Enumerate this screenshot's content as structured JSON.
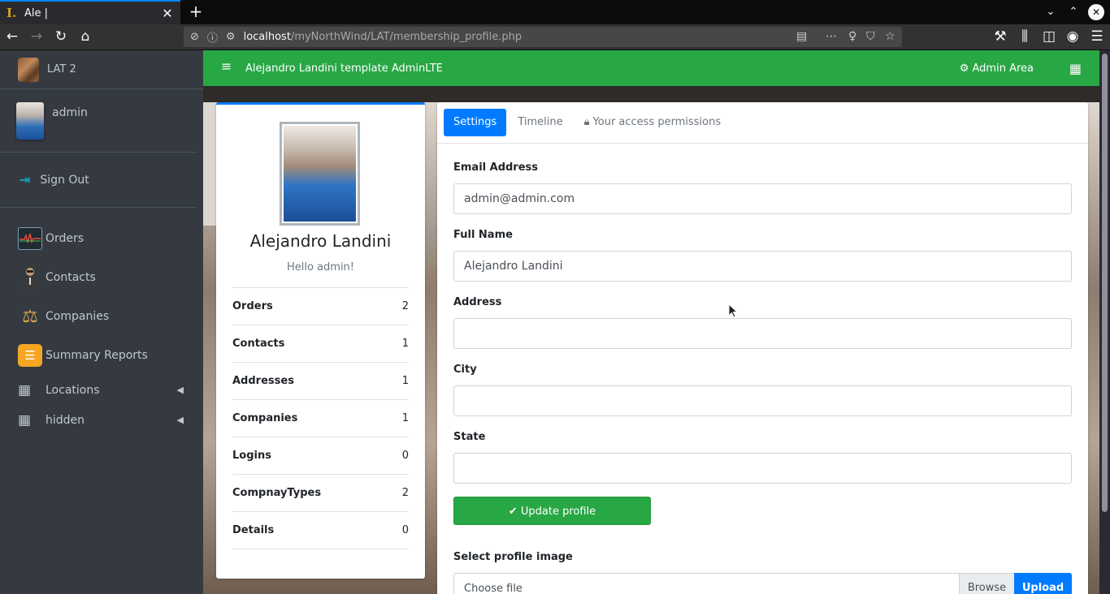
{
  "browser": {
    "tab_title": "Ale |",
    "tab_close": "✕",
    "new_tab": "+",
    "url_host": "localhost",
    "url_path": "/myNorthWind/LAT/membership_profile.php"
  },
  "sidebar": {
    "brand": "LAT 2",
    "user_name": "admin",
    "sign_out": "Sign Out",
    "items": [
      {
        "label": "Orders"
      },
      {
        "label": "Contacts"
      },
      {
        "label": "Companies"
      },
      {
        "label": "Summary Reports"
      },
      {
        "label": "Locations"
      },
      {
        "label": "hidden"
      }
    ]
  },
  "topbar": {
    "title": "Alejandro Landini template AdminLTE",
    "admin_area": "Admin Area"
  },
  "profile": {
    "name": "Alejandro Landini",
    "greeting": "Hello admin!",
    "stats": [
      {
        "label": "Orders",
        "value": "2"
      },
      {
        "label": "Contacts",
        "value": "1"
      },
      {
        "label": "Addresses",
        "value": "1"
      },
      {
        "label": "Companies",
        "value": "1"
      },
      {
        "label": "Logins",
        "value": "0"
      },
      {
        "label": "CompnayTypes",
        "value": "2"
      },
      {
        "label": "Details",
        "value": "0"
      }
    ]
  },
  "settings": {
    "tabs": [
      "Settings",
      "Timeline",
      "Your access permissions"
    ],
    "fields": [
      {
        "label": "Email Address",
        "value": "admin@admin.com"
      },
      {
        "label": "Full Name",
        "value": "Alejandro Landini"
      },
      {
        "label": "Address",
        "value": ""
      },
      {
        "label": "City",
        "value": ""
      },
      {
        "label": "State",
        "value": ""
      }
    ],
    "update_button": "Update profile",
    "image_label": "Select profile image",
    "choose_file": "Choose file",
    "browse": "Browse",
    "upload": "Upload"
  },
  "colors": {
    "topbar": "#28a745",
    "sidebar": "#343a40",
    "primary": "#007bff"
  }
}
